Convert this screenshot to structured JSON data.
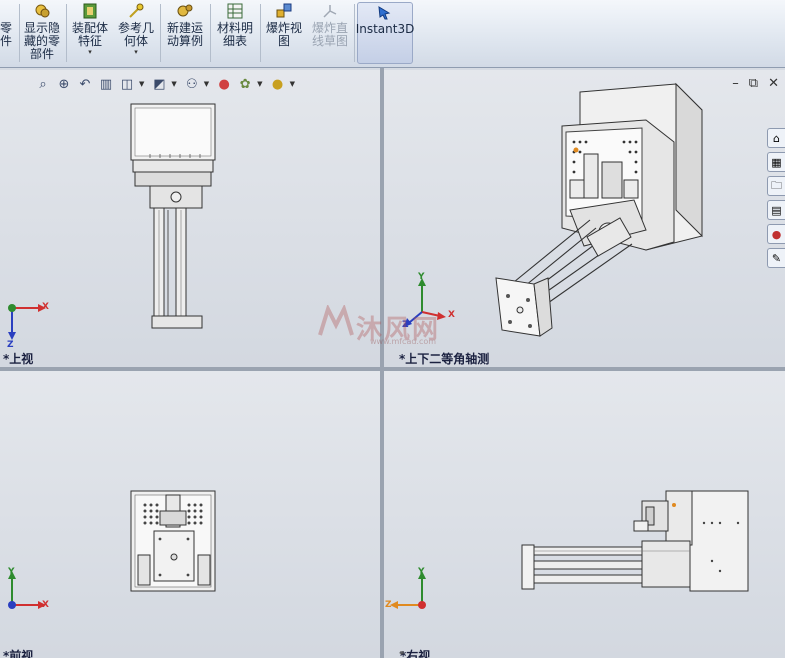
{
  "ribbon": {
    "buttons": [
      {
        "id": "insert-component",
        "label": "零\n件",
        "icon": "component-icon",
        "disabled": false
      },
      {
        "id": "show-hidden",
        "label": "显示隐\n藏的零\n部件",
        "icon": "show-hidden-icon",
        "disabled": false
      },
      {
        "id": "assembly-feature",
        "label": "装配体\n特征",
        "icon": "assembly-feature-icon",
        "disabled": false,
        "dropdown": "▾"
      },
      {
        "id": "reference-geometry",
        "label": "参考几\n何体",
        "icon": "reference-geometry-icon",
        "disabled": false,
        "dropdown": "▾"
      },
      {
        "id": "new-motion-study",
        "label": "新建运\n动算例",
        "icon": "motion-study-icon",
        "disabled": false
      },
      {
        "id": "bom",
        "label": "材料明\n细表",
        "icon": "bom-icon",
        "disabled": false
      },
      {
        "id": "exploded-view",
        "label": "爆炸视\n图",
        "icon": "exploded-view-icon",
        "disabled": false
      },
      {
        "id": "explode-line-sketch",
        "label": "爆炸直\n线草图",
        "icon": "explode-line-icon",
        "disabled": true
      },
      {
        "id": "instant3d",
        "label": "Instant3D",
        "icon": "instant3d-icon",
        "disabled": false
      }
    ]
  },
  "viewports": {
    "top": {
      "label": "*上视"
    },
    "iso": {
      "label": "*上下二等角轴测"
    },
    "front": {
      "label": "*前视"
    },
    "right": {
      "label": "*右视"
    }
  },
  "triad": {
    "x": "X",
    "y": "Y",
    "z": "Z"
  },
  "watermark": {
    "text": "沐风网",
    "url": "www.mfcad.com"
  },
  "colors": {
    "x_axis": "#d03030",
    "y_axis": "#2e8b2e",
    "z_axis": "#2a3fc0",
    "z_axis_right": "#e08a20"
  }
}
